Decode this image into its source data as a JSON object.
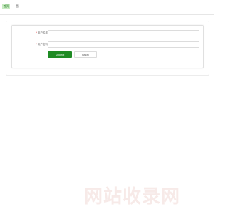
{
  "topbar": {
    "nav_items": [
      {
        "label": "首页"
      },
      {
        "label": "音"
      }
    ]
  },
  "form": {
    "fields": [
      {
        "required_mark": "*",
        "label": "用户名称",
        "value": "",
        "placeholder": ""
      },
      {
        "required_mark": "*",
        "label": "用户密码",
        "value": "",
        "placeholder": ""
      }
    ],
    "submit_label": "Submit",
    "reset_label": "Reset"
  },
  "watermark": {
    "text": "网站收录网"
  },
  "colors": {
    "accent": "#1f8b24",
    "nav_active_bg": "#c9ecc3",
    "watermark": "#f7eae8"
  }
}
